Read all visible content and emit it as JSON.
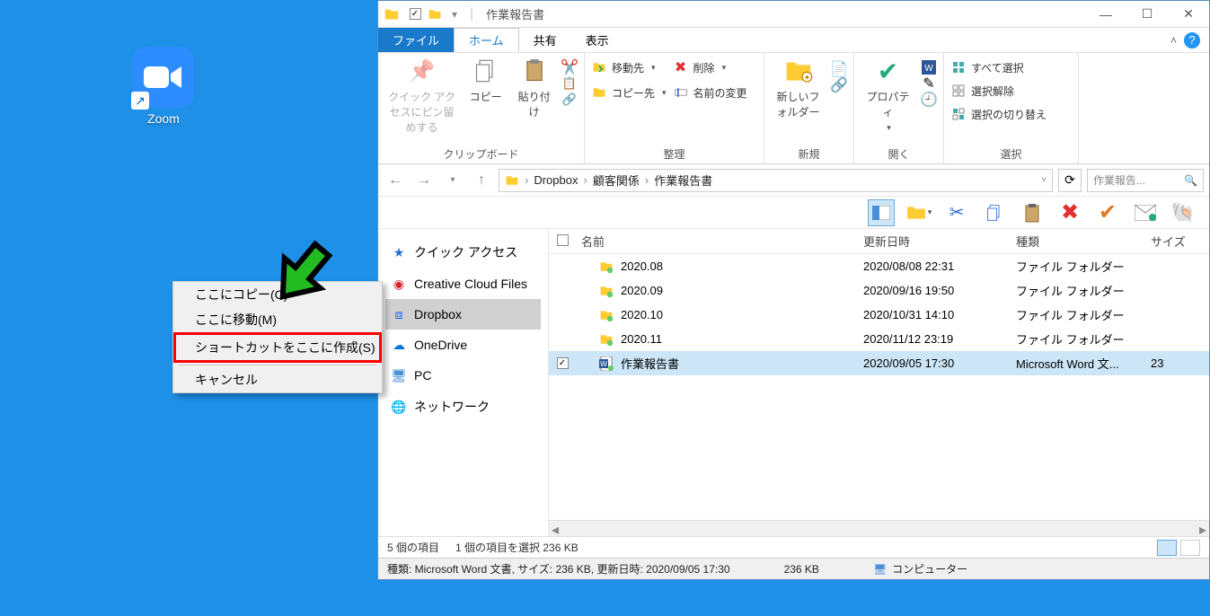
{
  "desktop": {
    "zoom_label": "Zoom"
  },
  "context_menu": {
    "copy_here": "ここにコピー(C)",
    "move_here": "ここに移動(M)",
    "create_shortcut_here": "ショートカットをここに作成(S)",
    "cancel": "キャンセル"
  },
  "explorer": {
    "title": "作業報告書",
    "tabs": {
      "file": "ファイル",
      "home": "ホーム",
      "share": "共有",
      "view": "表示"
    },
    "ribbon": {
      "clipboard": {
        "pin_quick_access": "クイック アクセスにピン留めする",
        "copy": "コピー",
        "paste": "貼り付け",
        "cut": "",
        "copy_path": "",
        "paste_shortcut": "",
        "group_label": "クリップボード"
      },
      "organize": {
        "move_to": "移動先",
        "copy_to": "コピー先",
        "delete": "削除",
        "rename": "名前の変更",
        "group_label": "整理"
      },
      "new": {
        "new_folder": "新しいフォルダー",
        "group_label": "新規"
      },
      "open": {
        "properties": "プロパティ",
        "group_label": "開く"
      },
      "select": {
        "select_all": "すべて選択",
        "select_none": "選択解除",
        "invert_selection": "選択の切り替え",
        "group_label": "選択"
      }
    },
    "breadcrumbs": [
      "Dropbox",
      "顧客関係",
      "作業報告書"
    ],
    "search_placeholder": "作業報告...",
    "nav_pane": [
      {
        "icon": "star",
        "label": "クイック アクセス"
      },
      {
        "icon": "cc",
        "label": "Creative Cloud Files"
      },
      {
        "icon": "dropbox",
        "label": "Dropbox"
      },
      {
        "icon": "onedrive",
        "label": "OneDrive"
      },
      {
        "icon": "pc",
        "label": "PC"
      },
      {
        "icon": "network",
        "label": "ネットワーク"
      }
    ],
    "columns": {
      "name": "名前",
      "date": "更新日時",
      "type": "種類",
      "size": "サイズ"
    },
    "files": [
      {
        "icon": "folder",
        "name": "2020.08",
        "date": "2020/08/08 22:31",
        "type": "ファイル フォルダー",
        "size": "",
        "checked": false,
        "selected": false
      },
      {
        "icon": "folder",
        "name": "2020.09",
        "date": "2020/09/16 19:50",
        "type": "ファイル フォルダー",
        "size": "",
        "checked": false,
        "selected": false
      },
      {
        "icon": "folder",
        "name": "2020.10",
        "date": "2020/10/31 14:10",
        "type": "ファイル フォルダー",
        "size": "",
        "checked": false,
        "selected": false
      },
      {
        "icon": "folder",
        "name": "2020.11",
        "date": "2020/11/12 23:19",
        "type": "ファイル フォルダー",
        "size": "",
        "checked": false,
        "selected": false
      },
      {
        "icon": "word",
        "name": "作業報告書",
        "date": "2020/09/05 17:30",
        "type": "Microsoft Word 文...",
        "size": "23",
        "checked": true,
        "selected": true
      }
    ],
    "status": {
      "item_count": "5 個の項目",
      "selection": "1 個の項目を選択 236 KB"
    },
    "details": {
      "left": "種類: Microsoft Word 文書, サイズ: 236 KB, 更新日時: 2020/09/05 17:30",
      "size": "236 KB",
      "location": "コンピューター"
    }
  }
}
